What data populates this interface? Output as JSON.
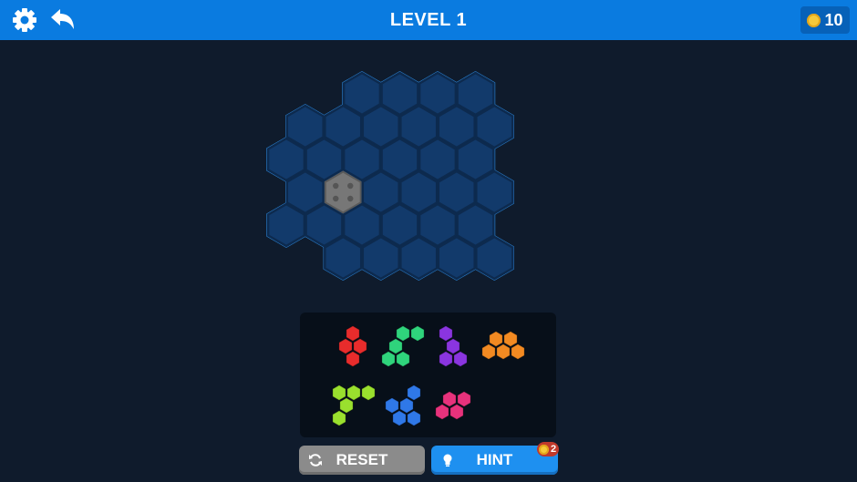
{
  "header": {
    "title": "LEVEL 1",
    "coins": "10",
    "settings_icon": "gear-icon",
    "back_icon": "undo-arrow-icon",
    "coin_icon": "coin-icon"
  },
  "board": {
    "rows": [
      {
        "cols": [
          2,
          3,
          4,
          5
        ]
      },
      {
        "cols": [
          1,
          2,
          3,
          4,
          5,
          6
        ]
      },
      {
        "cols": [
          0,
          1,
          2,
          3,
          4,
          5
        ]
      },
      {
        "cols": [
          1,
          2,
          3,
          4,
          5,
          6
        ]
      },
      {
        "cols": [
          0,
          1,
          2,
          3,
          4,
          5
        ]
      },
      {
        "cols": [
          2,
          3,
          4,
          5,
          6
        ]
      }
    ],
    "blocked_cell": {
      "row": 3,
      "col": 2
    },
    "cell_color": "#123a6b",
    "border_color": "#2f8fe6"
  },
  "pieces": [
    {
      "name": "red-piece",
      "color": "#e82c2c"
    },
    {
      "name": "green-piece",
      "color": "#2fd47c"
    },
    {
      "name": "purple-piece",
      "color": "#8a35e0"
    },
    {
      "name": "orange-piece",
      "color": "#f28a22"
    },
    {
      "name": "lime-piece",
      "color": "#9ae02e"
    },
    {
      "name": "blue-piece",
      "color": "#2f78e8"
    },
    {
      "name": "pink-piece",
      "color": "#e8327c"
    }
  ],
  "buttons": {
    "reset_label": "RESET",
    "hint_label": "HINT",
    "hint_cost": "2",
    "reset_icon": "refresh-icon",
    "hint_icon": "lightbulb-icon"
  }
}
